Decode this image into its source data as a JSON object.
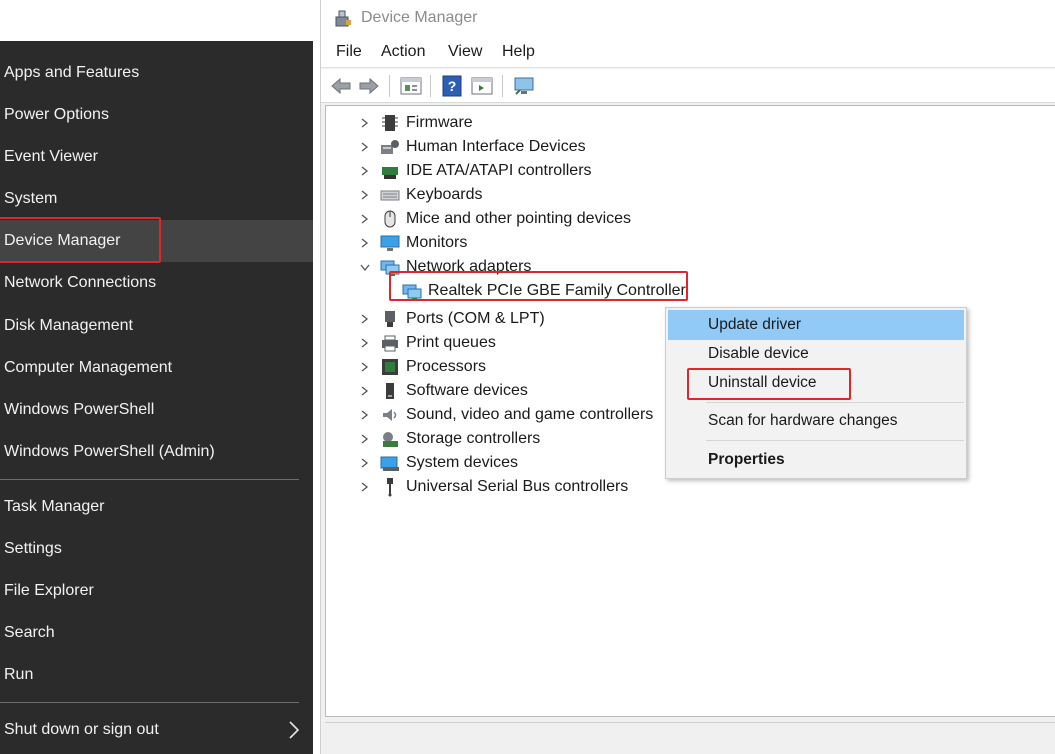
{
  "colors": {
    "menu_bg": "#2b2b2b",
    "menu_highlight": "#444444",
    "menu_text": "#f2f2f2",
    "annotation_red": "#e0252b",
    "context_hover": "#91c9f7"
  },
  "winx_menu": {
    "items": [
      {
        "label": "Apps and Features"
      },
      {
        "label": "Power Options"
      },
      {
        "label": "Event Viewer"
      },
      {
        "label": "System"
      },
      {
        "label": "Device Manager"
      },
      {
        "label": "Network Connections"
      },
      {
        "label": "Disk Management"
      },
      {
        "label": "Computer Management"
      },
      {
        "label": "Windows PowerShell"
      },
      {
        "label": "Windows PowerShell (Admin)"
      },
      {
        "label": "Task Manager"
      },
      {
        "label": "Settings"
      },
      {
        "label": "File Explorer"
      },
      {
        "label": "Search"
      },
      {
        "label": "Run"
      },
      {
        "label": "Shut down or sign out"
      }
    ],
    "highlighted": "Device Manager"
  },
  "device_manager": {
    "title": "Device Manager",
    "menu": [
      "File",
      "Action",
      "View",
      "Help"
    ],
    "toolbar_icons": [
      "back-icon",
      "forward-icon",
      "properties-sheet-icon",
      "help-icon",
      "run-view-icon",
      "monitor-scan-icon"
    ],
    "tree": [
      {
        "label": "Firmware",
        "icon": "firmware-icon",
        "expanded": false
      },
      {
        "label": "Human Interface Devices",
        "icon": "hid-icon",
        "expanded": false
      },
      {
        "label": "IDE ATA/ATAPI controllers",
        "icon": "ide-icon",
        "expanded": false
      },
      {
        "label": "Keyboards",
        "icon": "keyboard-icon",
        "expanded": false
      },
      {
        "label": "Mice and other pointing devices",
        "icon": "mouse-icon",
        "expanded": false
      },
      {
        "label": "Monitors",
        "icon": "monitor-icon",
        "expanded": false
      },
      {
        "label": "Network adapters",
        "icon": "network-adapter-icon",
        "expanded": true
      },
      {
        "label": "Realtek PCIe GBE Family Controller",
        "icon": "network-adapter-icon",
        "child": true
      },
      {
        "label": "Ports (COM & LPT)",
        "icon": "port-icon",
        "expanded": false
      },
      {
        "label": "Print queues",
        "icon": "printer-icon",
        "expanded": false
      },
      {
        "label": "Processors",
        "icon": "processor-icon",
        "expanded": false
      },
      {
        "label": "Software devices",
        "icon": "software-device-icon",
        "expanded": false
      },
      {
        "label": "Sound, video and game controllers",
        "icon": "speaker-icon",
        "expanded": false
      },
      {
        "label": "Storage controllers",
        "icon": "storage-icon",
        "expanded": false
      },
      {
        "label": "System devices",
        "icon": "system-device-icon",
        "expanded": false
      },
      {
        "label": "Universal Serial Bus controllers",
        "icon": "usb-icon",
        "expanded": false
      }
    ]
  },
  "context_menu": {
    "items": [
      {
        "label": "Update driver"
      },
      {
        "label": "Disable device"
      },
      {
        "label": "Uninstall device"
      },
      {
        "label": "Scan for hardware changes"
      },
      {
        "label": "Properties"
      }
    ],
    "hovered": "Update driver",
    "default_item": "Properties"
  }
}
